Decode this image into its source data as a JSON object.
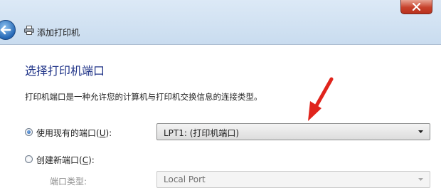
{
  "window": {
    "title": "添加打印机",
    "close_glyph": "x"
  },
  "page": {
    "heading": "选择打印机端口",
    "description": "打印机端口是一种允许您的计算机与打印机交换信息的连接类型。"
  },
  "options": {
    "existing": {
      "label_prefix": "使用现有的端口(",
      "accel": "U",
      "label_suffix": "):",
      "selected": true,
      "value": "LPT1: (打印机端口)"
    },
    "create": {
      "label_prefix": "创建新端口(",
      "accel": "C",
      "label_suffix": "):",
      "selected": false,
      "port_type_label": "端口类型:",
      "port_type_value": "Local Port"
    }
  },
  "colors": {
    "heading": "#1e3287",
    "annotation_arrow": "#e0241c"
  },
  "icons": {
    "back": "back-arrow-icon",
    "printer": "printer-icon",
    "close": "close-icon",
    "dropdown": "chevron-down-icon"
  }
}
